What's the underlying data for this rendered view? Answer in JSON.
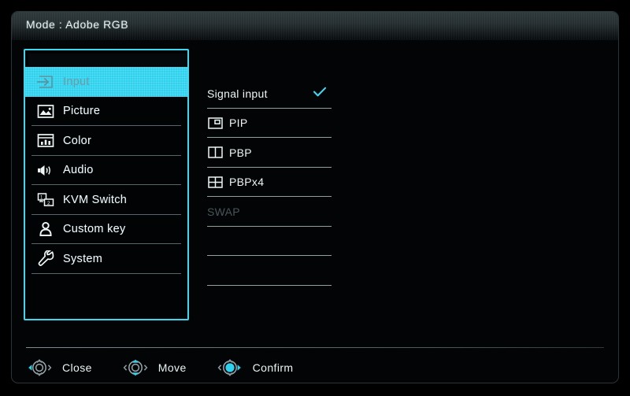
{
  "header": {
    "title": "Mode : Adobe RGB",
    "mode_label": "Mode",
    "mode_value": "Adobe RGB"
  },
  "colors": {
    "accent": "#2ed2ee",
    "accent_border": "#3fd6f0",
    "background": "#020406",
    "text": "#eef6f6",
    "disabled_text": "#4a5558",
    "selected_text": "#6e9ba6",
    "separator": "#c8ded2"
  },
  "sidebar": {
    "items": [
      {
        "label": "Input",
        "icon": "input-arrow-icon",
        "selected": true
      },
      {
        "label": "Picture",
        "icon": "picture-icon",
        "selected": false
      },
      {
        "label": "Color",
        "icon": "color-bars-icon",
        "selected": false
      },
      {
        "label": "Audio",
        "icon": "speaker-icon",
        "selected": false
      },
      {
        "label": "KVM Switch",
        "icon": "kvm-switch-icon",
        "selected": false
      },
      {
        "label": "Custom key",
        "icon": "person-icon",
        "selected": false
      },
      {
        "label": "System",
        "icon": "wrench-icon",
        "selected": false
      }
    ]
  },
  "options": {
    "items": [
      {
        "label": "Signal input",
        "icon": null,
        "checked": true,
        "disabled": false,
        "check_glyph": "✓"
      },
      {
        "label": "PIP",
        "icon": "pip-icon",
        "checked": false,
        "disabled": false
      },
      {
        "label": "PBP",
        "icon": "pbp-icon",
        "checked": false,
        "disabled": false
      },
      {
        "label": "PBPx4",
        "icon": "pbpx4-icon",
        "checked": false,
        "disabled": false
      },
      {
        "label": "SWAP",
        "icon": null,
        "checked": false,
        "disabled": true
      },
      {
        "label": "",
        "icon": null,
        "checked": false,
        "disabled": false
      },
      {
        "label": "",
        "icon": null,
        "checked": false,
        "disabled": false
      }
    ]
  },
  "footer": {
    "hints": [
      {
        "label": "Close",
        "icon": "dpad-left-icon",
        "active": "left"
      },
      {
        "label": "Move",
        "icon": "dpad-updown-icon",
        "active": "updown"
      },
      {
        "label": "Confirm",
        "icon": "dpad-center-icon",
        "active": "center"
      }
    ]
  }
}
